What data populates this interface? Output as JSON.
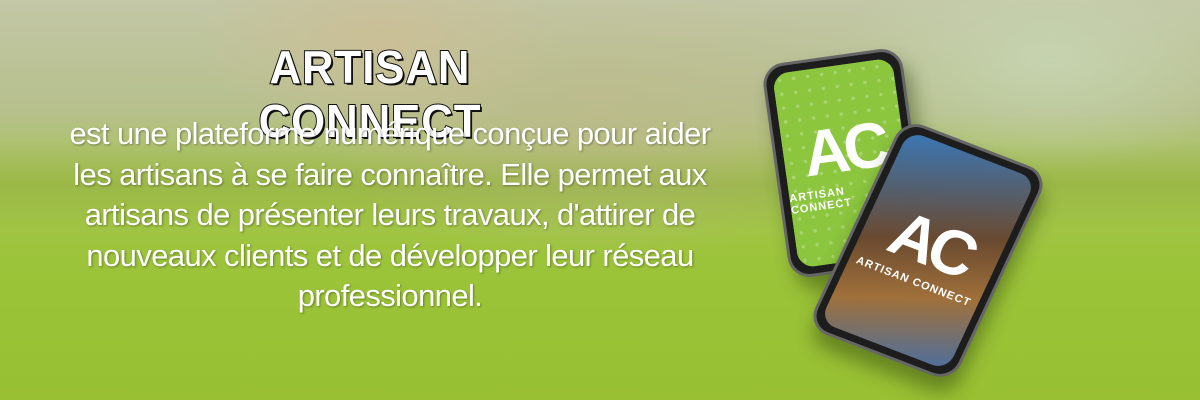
{
  "title": "ARTISAN CONNECT",
  "description": "est une plateforme numérique conçue pour aider les artisans à se faire connaître. Elle permet aux artisans de présenter leurs travaux, d'attirer de nouveaux clients et de développer leur réseau professionnel.",
  "description_lines": [
    "est une plateforme numérique conçue pour aider",
    "les artisans à se faire connaître. Elle permet aux",
    "artisans de présenter leurs travaux, d'attirer de",
    "nouveaux clients et de développer leur réseau",
    "professionnel."
  ],
  "phones": [
    {
      "logo": "AC",
      "logo_text": "ARTISAN CONNECT",
      "screen_color": "#8cc63f"
    },
    {
      "logo": "AC",
      "logo_text": "ARTISAN CONNECT"
    }
  ]
}
